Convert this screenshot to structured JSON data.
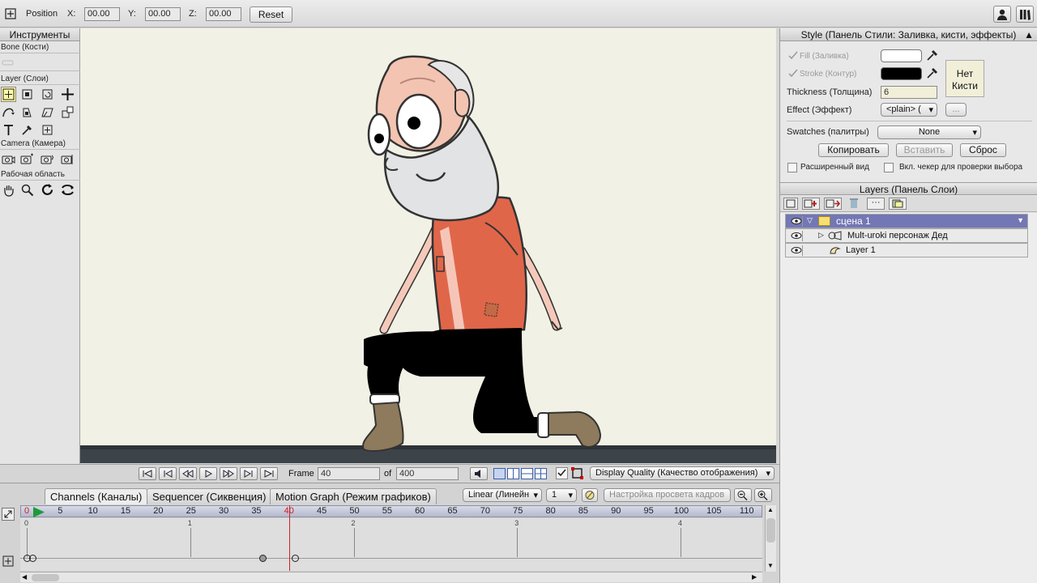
{
  "toolbar": {
    "position_label": "Position",
    "x_label": "X:",
    "x_value": "00.00",
    "y_label": "Y:",
    "y_value": "00.00",
    "z_label": "Z:",
    "z_value": "00.00",
    "reset_label": "Reset"
  },
  "tools": {
    "title": "Инструменты",
    "bone_label": "Bone (Кости)",
    "layer_label": "Layer (Слои)",
    "camera_label": "Camera (Камера)",
    "workspace_label": "Рабочая область"
  },
  "playback": {
    "frame_label": "Frame",
    "frame_value": "40",
    "of_label": "of",
    "total_value": "400",
    "display_quality": "Display Quality (Качество отображения)"
  },
  "timeline": {
    "tabs": [
      "Channels (Каналы)",
      "Sequencer (Сиквенция)",
      "Motion Graph (Режим графиков)"
    ],
    "interpolation": "Linear (Линейн",
    "step_value": "1",
    "onion_label": "Настройка просвета кадров",
    "ruler_start": "0",
    "ruler_labels": [
      "5",
      "10",
      "15",
      "20",
      "25",
      "30",
      "35",
      "40",
      "45",
      "50",
      "55",
      "60",
      "65",
      "70",
      "75",
      "80",
      "85",
      "90",
      "95",
      "100",
      "105",
      "110"
    ],
    "second_labels": [
      "0",
      "1",
      "2",
      "3",
      "4"
    ],
    "current_frame": 40
  },
  "style_panel": {
    "title": "Style (Панель Стили: Заливка, кисти, эффекты)",
    "fill_label": "Fill (Заливка)",
    "stroke_label": "Stroke (Контур)",
    "thickness_label": "Thickness (Толщина)",
    "thickness_value": "6",
    "effect_label": "Effect (Эффект)",
    "effect_value": "<plain> (",
    "effect_more": "...",
    "no_brush": "Нет Кисти",
    "swatches_label": "Swatches (палитры)",
    "swatches_value": "None",
    "copy_label": "Копировать",
    "paste_label": "Вставить",
    "reset_label": "Сброс",
    "advanced_label": "Расширенный вид",
    "checker_label": "Вкл. чекер для проверки выбора",
    "fill_color": "#ffffff",
    "stroke_color": "#000000"
  },
  "layers_panel": {
    "title": "Layers (Панель Слои)",
    "layers": [
      {
        "name": "сцена 1"
      },
      {
        "name": "Mult-uroki персонаж Дед"
      },
      {
        "name": "Layer 1"
      }
    ]
  },
  "colors": {
    "selected_layer": "#7377b5",
    "playhead": "#d02020",
    "canvas_bg": "#f2f1e5",
    "shirt": "#e0664a"
  }
}
